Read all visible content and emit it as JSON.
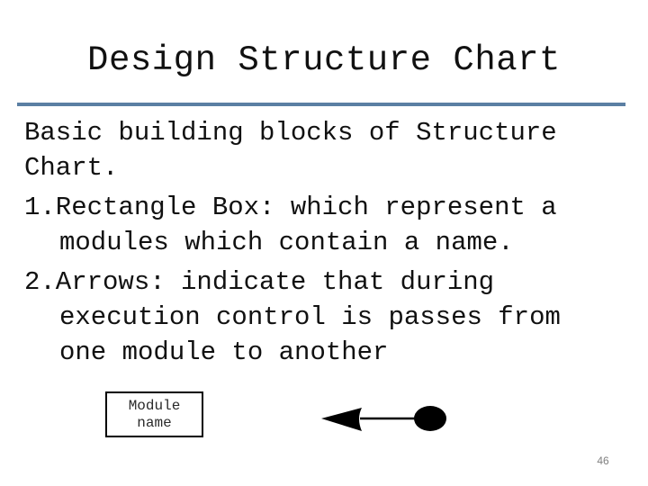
{
  "slide": {
    "title": "Design Structure Chart",
    "accent_color": "#5b7fa3",
    "page_number": "46"
  },
  "content": {
    "lines": [
      "Basic building blocks of Structure",
      "Chart.",
      "1.Rectangle Box: which represent a",
      "modules which contain a name.",
      "2.Arrows: indicate that during",
      "execution control is passes from",
      "one module to another"
    ]
  },
  "diagram": {
    "module_box": {
      "line1": "Module",
      "line2": "name"
    },
    "arrow": {
      "icon": "control-arrow-icon",
      "direction": "left",
      "tail": "filled-circle"
    }
  }
}
